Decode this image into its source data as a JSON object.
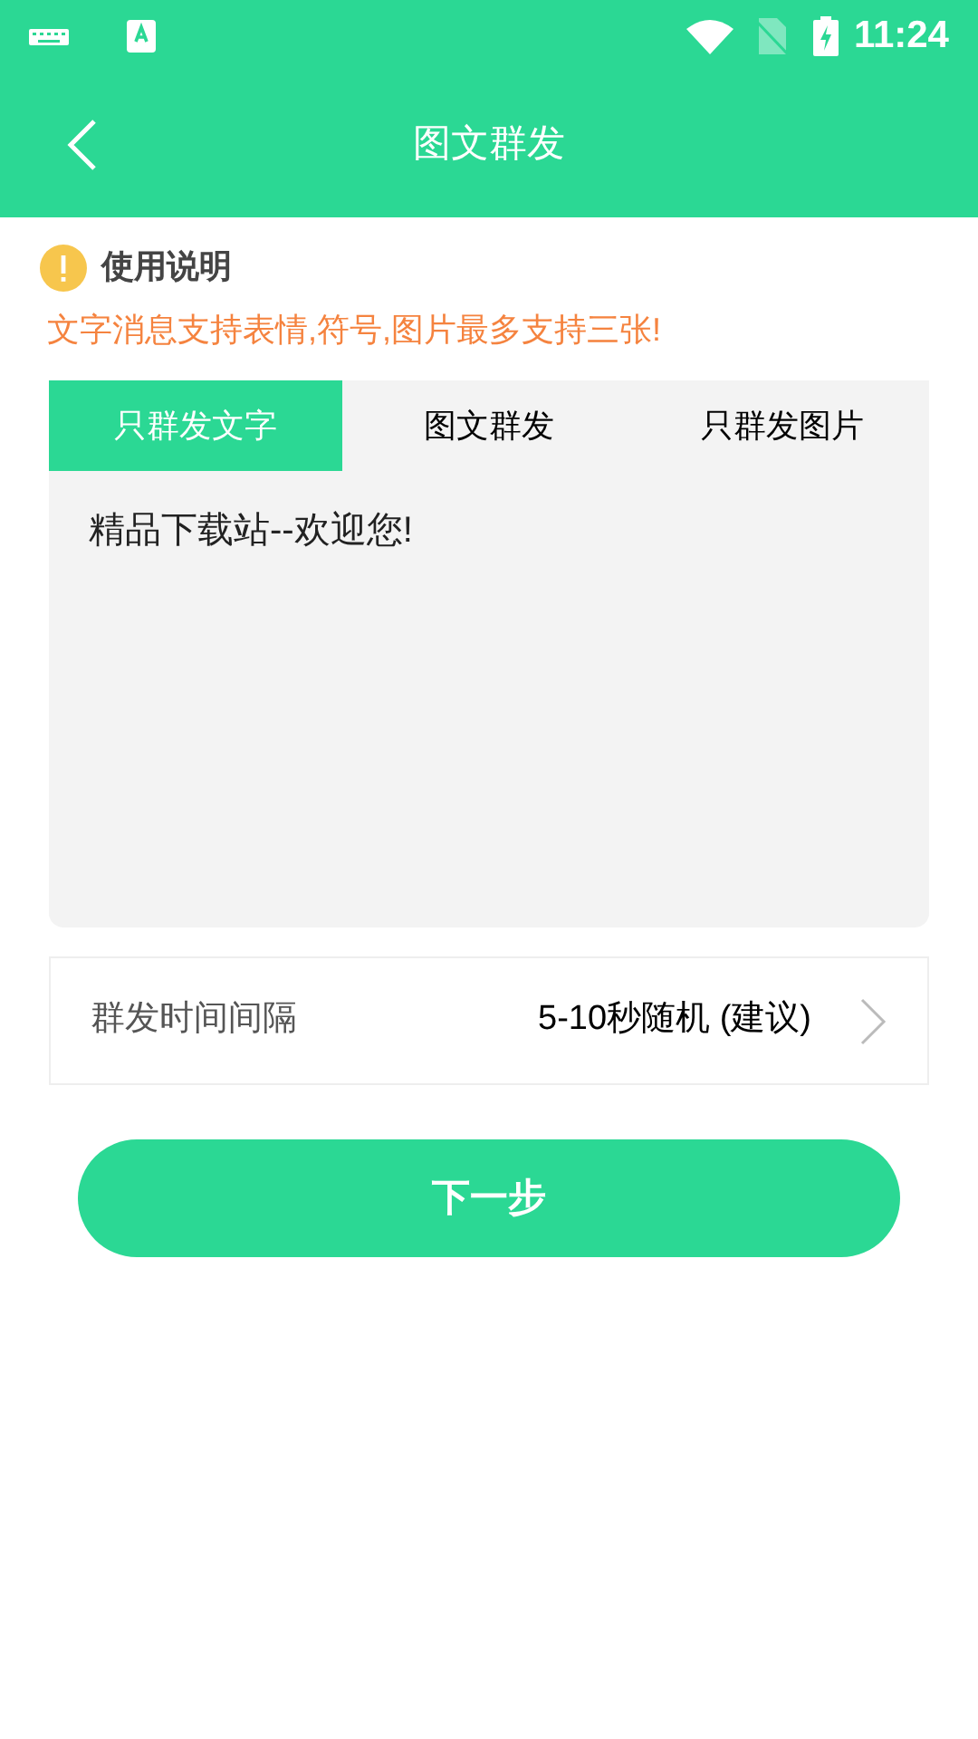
{
  "status_bar": {
    "time": "11:24"
  },
  "header": {
    "title": "图文群发"
  },
  "notice": {
    "title": "使用说明",
    "text": "文字消息支持表情,符号,图片最多支持三张!"
  },
  "tabs": [
    {
      "label": "只群发文字",
      "selected": true
    },
    {
      "label": "图文群发",
      "selected": false
    },
    {
      "label": "只群发图片",
      "selected": false
    }
  ],
  "message": {
    "value": "精品下载站--欢迎您!"
  },
  "interval": {
    "label": "群发时间间隔",
    "value": "5-10秒随机 (建议)"
  },
  "next_button": {
    "label": "下一步"
  }
}
